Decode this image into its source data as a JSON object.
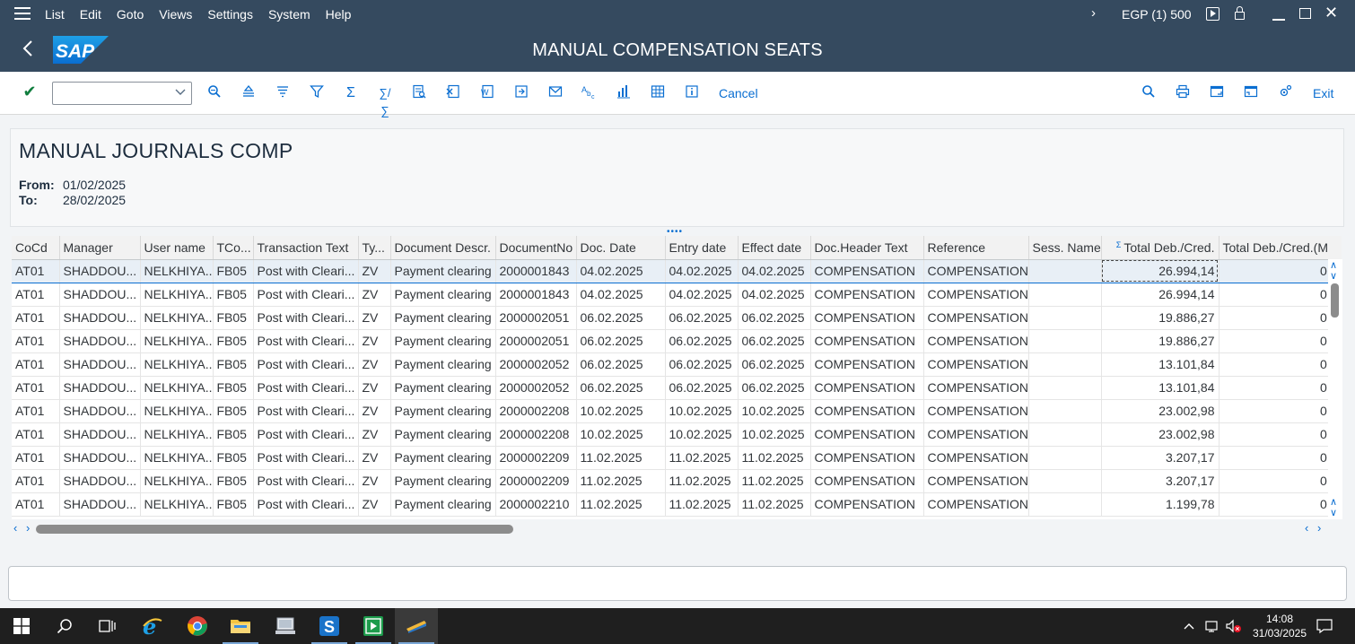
{
  "menubar": {
    "items": [
      "List",
      "Edit",
      "Goto",
      "Views",
      "Settings",
      "System",
      "Help"
    ],
    "system_info": "EGP (1) 500"
  },
  "titlebar": {
    "title": "MANUAL COMPENSATION SEATS",
    "logo_text": "SAP"
  },
  "toolbar": {
    "cancel_label": "Cancel",
    "exit_label": "Exit",
    "command_field_value": ""
  },
  "header": {
    "report_title": "MANUAL JOURNALS COMP",
    "from_label": "From:",
    "from_value": "01/02/2025",
    "to_label": "To:",
    "to_value": "28/02/2025"
  },
  "grid": {
    "columns": [
      "CoCd",
      "Manager",
      "User name",
      "TCo...",
      "Transaction Text",
      "Ty...",
      "Document Descr.",
      "DocumentNo",
      "Doc. Date",
      "Entry date",
      "Effect date",
      "Doc.Header Text",
      "Reference",
      "Sess. Name",
      "Total Deb./Cred.",
      "Total Deb./Cred.(M"
    ],
    "rows": [
      [
        "AT01",
        "SHADDOU...",
        "NELKHIYA...",
        "FB05",
        "Post with Cleari...",
        "ZV",
        "Payment clearing",
        "2000001843",
        "04.02.2025",
        "04.02.2025",
        "04.02.2025",
        "COMPENSATION",
        "COMPENSATION",
        "",
        "26.994,14",
        "0,0"
      ],
      [
        "AT01",
        "SHADDOU...",
        "NELKHIYA...",
        "FB05",
        "Post with Cleari...",
        "ZV",
        "Payment clearing",
        "2000001843",
        "04.02.2025",
        "04.02.2025",
        "04.02.2025",
        "COMPENSATION",
        "COMPENSATION",
        "",
        "26.994,14",
        "0,0"
      ],
      [
        "AT01",
        "SHADDOU...",
        "NELKHIYA...",
        "FB05",
        "Post with Cleari...",
        "ZV",
        "Payment clearing",
        "2000002051",
        "06.02.2025",
        "06.02.2025",
        "06.02.2025",
        "COMPENSATION",
        "COMPENSATION",
        "",
        "19.886,27",
        "0,0"
      ],
      [
        "AT01",
        "SHADDOU...",
        "NELKHIYA...",
        "FB05",
        "Post with Cleari...",
        "ZV",
        "Payment clearing",
        "2000002051",
        "06.02.2025",
        "06.02.2025",
        "06.02.2025",
        "COMPENSATION",
        "COMPENSATION",
        "",
        "19.886,27",
        "0,0"
      ],
      [
        "AT01",
        "SHADDOU...",
        "NELKHIYA...",
        "FB05",
        "Post with Cleari...",
        "ZV",
        "Payment clearing",
        "2000002052",
        "06.02.2025",
        "06.02.2025",
        "06.02.2025",
        "COMPENSATION",
        "COMPENSATION",
        "",
        "13.101,84",
        "0,0"
      ],
      [
        "AT01",
        "SHADDOU...",
        "NELKHIYA...",
        "FB05",
        "Post with Cleari...",
        "ZV",
        "Payment clearing",
        "2000002052",
        "06.02.2025",
        "06.02.2025",
        "06.02.2025",
        "COMPENSATION",
        "COMPENSATION",
        "",
        "13.101,84",
        "0,0"
      ],
      [
        "AT01",
        "SHADDOU...",
        "NELKHIYA...",
        "FB05",
        "Post with Cleari...",
        "ZV",
        "Payment clearing",
        "2000002208",
        "10.02.2025",
        "10.02.2025",
        "10.02.2025",
        "COMPENSATION",
        "COMPENSATION",
        "",
        "23.002,98",
        "0,0"
      ],
      [
        "AT01",
        "SHADDOU...",
        "NELKHIYA...",
        "FB05",
        "Post with Cleari...",
        "ZV",
        "Payment clearing",
        "2000002208",
        "10.02.2025",
        "10.02.2025",
        "10.02.2025",
        "COMPENSATION",
        "COMPENSATION",
        "",
        "23.002,98",
        "0,0"
      ],
      [
        "AT01",
        "SHADDOU...",
        "NELKHIYA...",
        "FB05",
        "Post with Cleari...",
        "ZV",
        "Payment clearing",
        "2000002209",
        "11.02.2025",
        "11.02.2025",
        "11.02.2025",
        "COMPENSATION",
        "COMPENSATION",
        "",
        "3.207,17",
        "0,0"
      ],
      [
        "AT01",
        "SHADDOU...",
        "NELKHIYA...",
        "FB05",
        "Post with Cleari...",
        "ZV",
        "Payment clearing",
        "2000002209",
        "11.02.2025",
        "11.02.2025",
        "11.02.2025",
        "COMPENSATION",
        "COMPENSATION",
        "",
        "3.207,17",
        "0,0"
      ],
      [
        "AT01",
        "SHADDOU...",
        "NELKHIYA...",
        "FB05",
        "Post with Cleari...",
        "ZV",
        "Payment clearing",
        "2000002210",
        "11.02.2025",
        "11.02.2025",
        "11.02.2025",
        "COMPENSATION",
        "COMPENSATION",
        "",
        "1.199,78",
        "0,0"
      ]
    ]
  },
  "taskbar": {
    "time": "14:08",
    "date": "31/03/2025"
  },
  "colors": {
    "shell": "#354a5f",
    "accent": "#0a6ed1",
    "check": "#107e3e"
  }
}
